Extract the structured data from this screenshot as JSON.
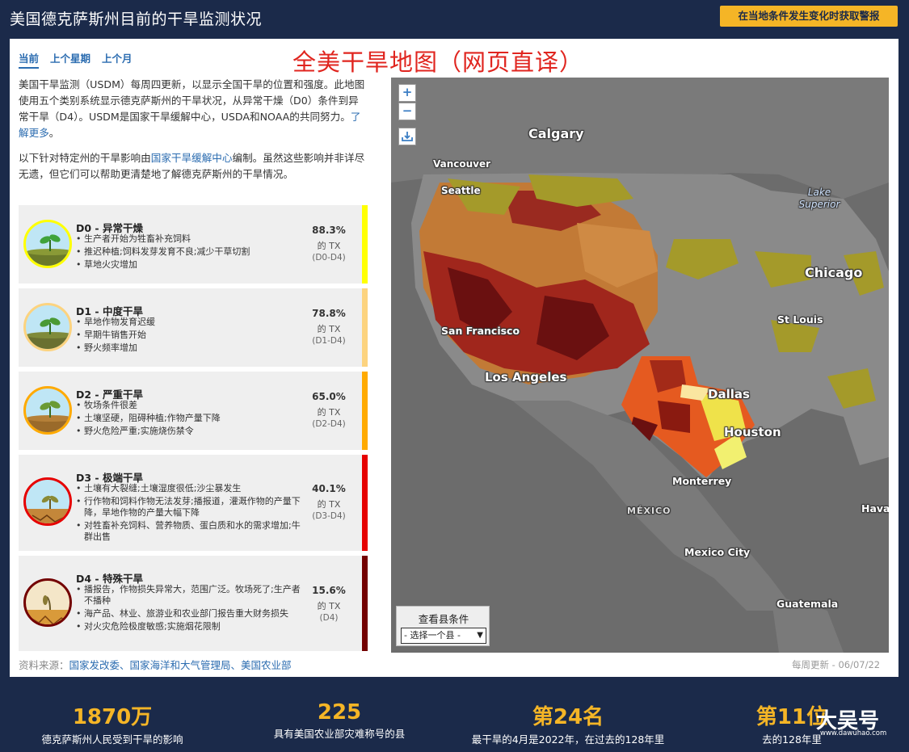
{
  "header": {
    "title": "美国德克萨斯州目前的干旱监测状况",
    "alert_button": "在当地条件发生变化时获取警报"
  },
  "tabs": [
    {
      "label": "当前",
      "active": true
    },
    {
      "label": "上个星期",
      "active": false
    },
    {
      "label": "上个月",
      "active": false
    }
  ],
  "annotation": "全美干旱地图（网页直译）",
  "intro": {
    "p1_text": "美国干旱监测（USDM）每周四更新，以显示全国干旱的位置和强度。此地图使用五个类别系统显示德克萨斯州的干旱状况，从异常干燥（D0）条件到异常干旱（D4）。USDM是国家干旱缓解中心，USDA和NOAA的共同努力。",
    "p1_link": "了解更多",
    "p1_end": "。",
    "p2_start": "以下针对特定州的干旱影响由",
    "p2_link": "国家干旱缓解中心",
    "p2_end": "编制。虽然这些影响并非详尽无遗，但它们可以帮助更清楚地了解德克萨斯州的干旱情况。"
  },
  "categories": [
    {
      "title": "D0 - 异常干燥",
      "percent": "88.3%",
      "of": "的 TX",
      "range": "(D0-D4)",
      "color": "#ffff00",
      "impacts": [
        "生产者开始为牲畜补充饲料",
        "推迟种植;饲料发芽发育不良;减少干草切割",
        "草地火灾增加"
      ]
    },
    {
      "title": "D1 - 中度干旱",
      "percent": "78.8%",
      "of": "的 TX",
      "range": "(D1-D4)",
      "color": "#fcd37f",
      "impacts": [
        "旱地作物发育迟缓",
        "早期牛销售开始",
        "野火频率增加"
      ]
    },
    {
      "title": "D2 - 严重干旱",
      "percent": "65.0%",
      "of": "的 TX",
      "range": "(D2-D4)",
      "color": "#ffaa00",
      "impacts": [
        "牧场条件很差",
        "土壤坚硬，阻碍种植;作物产量下降",
        "野火危险严重;实施烧伤禁令"
      ]
    },
    {
      "title": "D3 - 极端干旱",
      "percent": "40.1%",
      "of": "的 TX",
      "range": "(D3-D4)",
      "color": "#e60000",
      "impacts": [
        "土壤有大裂缝;土壤湿度很低;沙尘暴发生",
        "行作物和饲料作物无法发芽;播报道，灌溉作物的产量下降，旱地作物的产量大幅下降",
        "对牲畜补充饲料、营养物质、蛋白质和水的需求增加;牛群出售"
      ]
    },
    {
      "title": "D4 - 特殊干旱",
      "percent": "15.6%",
      "of": "的 TX",
      "range": "(D4)",
      "color": "#730000",
      "impacts": [
        "播报告，作物损失异常大，范围广泛。牧场死了;生产者不播种",
        "海产品、林业、旅游业和农业部门报告重大财务损失",
        "对火灾危险极度敏感;实施烟花限制"
      ]
    }
  ],
  "source": {
    "label": "资料来源：",
    "links": "国家发改委、国家海洋和大气管理局、美国农业部"
  },
  "updated": "每周更新 - 06/07/22",
  "map": {
    "zoom_in": "+",
    "zoom_out": "−",
    "labels": {
      "calgary": "Calgary",
      "vancouver": "Vancouver",
      "seattle": "Seattle",
      "lake_superior": "Lake Superior",
      "chicago": "Chicago",
      "st_louis": "St Louis",
      "san_francisco": "San Francisco",
      "los_angeles": "Los Angeles",
      "dallas": "Dallas",
      "houston": "Houston",
      "monterrey": "Monterrey",
      "mexico": "MÉXICO",
      "mexico_city": "Mexico City",
      "guatemala": "Guatemala",
      "havana": "Hava"
    },
    "county_label": "查看县条件",
    "county_select": "- 选择一个县 -"
  },
  "stats": [
    {
      "num": "1870万",
      "label": "德克萨斯州人民受到干旱的影响"
    },
    {
      "num": "225",
      "label": "具有美国农业部灾难称号的县"
    },
    {
      "num": "第24名",
      "label": "最干旱的4月是2022年，在过去的128年里"
    },
    {
      "num": "第11位",
      "label": "去的128年里"
    }
  ],
  "watermark": {
    "text": "大吴号",
    "url": "www.dawuhao.com"
  }
}
